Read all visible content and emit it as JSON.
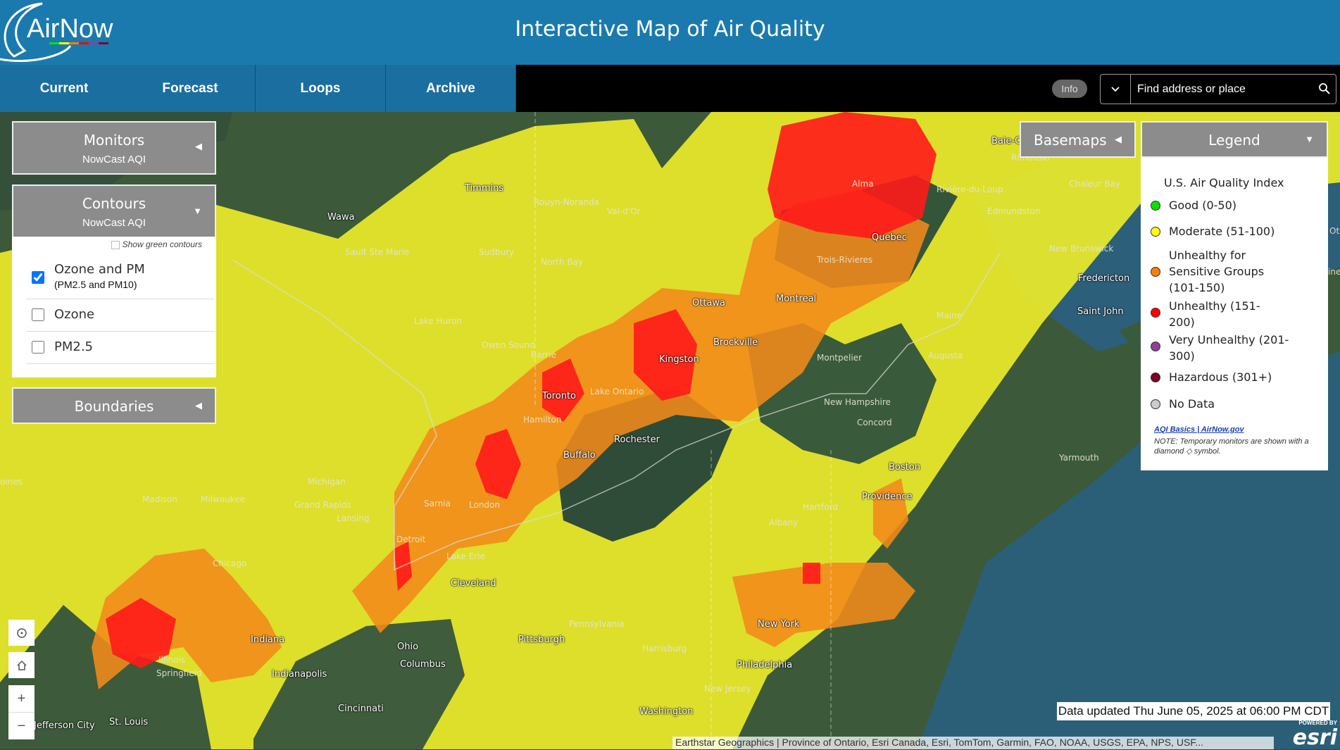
{
  "header": {
    "logo_text": "AirNow",
    "title": "Interactive Map of Air Quality"
  },
  "nav": {
    "tabs": [
      {
        "label": "Current"
      },
      {
        "label": "Forecast"
      },
      {
        "label": "Loops"
      },
      {
        "label": "Archive"
      }
    ]
  },
  "info_button": "Info",
  "search": {
    "placeholder": "Find address or place"
  },
  "panels": {
    "monitors": {
      "title": "Monitors",
      "subtitle": "NowCast AQI"
    },
    "contours": {
      "title": "Contours",
      "subtitle": "NowCast AQI",
      "show_green": "Show green contours",
      "options": [
        {
          "label": "Ozone and PM",
          "sublabel": "(PM2.5 and PM10)",
          "checked": true
        },
        {
          "label": "Ozone",
          "checked": false
        },
        {
          "label": "PM2.5",
          "checked": false
        }
      ]
    },
    "boundaries": {
      "title": "Boundaries"
    },
    "basemaps": {
      "title": "Basemaps"
    }
  },
  "legend": {
    "title": "Legend",
    "heading": "U.S. Air Quality Index",
    "items": [
      {
        "label": "Good (0-50)",
        "color": "#00e400"
      },
      {
        "label": "Moderate (51-100)",
        "color": "#ffff00"
      },
      {
        "label": "Unhealthy for Sensitive Groups (101-150)",
        "color": "#ff7e00"
      },
      {
        "label": "Unhealthy (151-200)",
        "color": "#ff0000"
      },
      {
        "label": "Very Unhealthy (201-300)",
        "color": "#8f3f97"
      },
      {
        "label": "Hazardous (301+)",
        "color": "#7e0023"
      },
      {
        "label": "No Data",
        "color": "#cccccc"
      }
    ],
    "link": "AQI Basics | AirNow.gov",
    "note": "NOTE: Temporary monitors are shown with a diamond ◇ symbol."
  },
  "map": {
    "updated": "Data updated Thu June 05, 2025 at 06:00 PM CDT",
    "attribution": "Earthstar Geographics | Province of Ontario, Esri Canada, Esri, TomTom, Garmin, FAO, NOAA, USGS, EPA, NPS, USF...",
    "esri_powered": "POWERED BY",
    "esri_logo": "esri",
    "cities": [
      "Timmins",
      "Wawa",
      "Rouyn-Noranda",
      "Val-d'Or",
      "Alma",
      "Baie-C",
      "Rimouski",
      "Rivière-du-Loup",
      "Edmundston",
      "Chaleur Bay",
      "Quebec",
      "New Brunswick",
      "Fredericton",
      "Saint John",
      "Trois-Rivieres",
      "Montreal",
      "Ottawa",
      "North Bay",
      "Sudbury",
      "Sault Ste Marie",
      "Lake Huron",
      "Owen Sound",
      "Barrie",
      "Toronto",
      "Hamilton",
      "Lake Ontario",
      "Kingston",
      "Brockville",
      "Montpelier",
      "Augusta",
      "Maine",
      "Yarmouth",
      "New Hampshire",
      "Concord",
      "Boston",
      "Providence",
      "Hartford",
      "Albany",
      "New York",
      "Rochester",
      "Buffalo",
      "Sarnia",
      "London",
      "Detroit",
      "Lake Erie",
      "Cleveland",
      "Michigan",
      "Grand Rapids",
      "Lansing",
      "Madison",
      "Milwaukee",
      "Chicago",
      "Illinois",
      "Springfield",
      "Indiana",
      "Indianapolis",
      "Ohio",
      "Columbus",
      "Cincinnati",
      "Pennsylvania",
      "Pittsburgh",
      "Harrisburg",
      "Philadelphia",
      "New Jersey",
      "Washington",
      "St. Louis",
      "Jefferson City",
      "oines",
      "ine",
      "Ot"
    ]
  }
}
